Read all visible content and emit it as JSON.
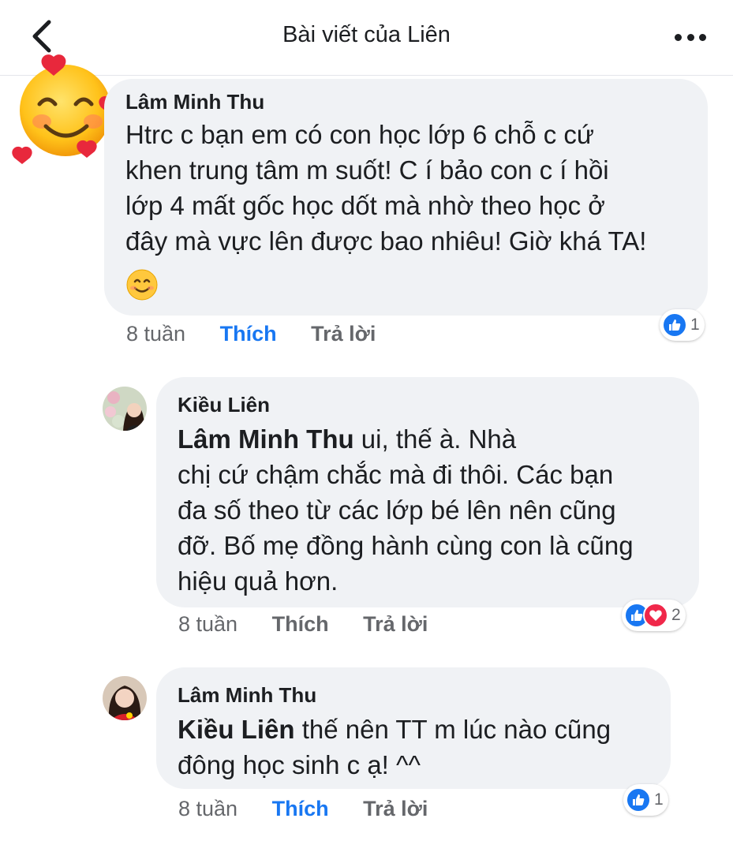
{
  "header": {
    "title": "Bài viết của Liên",
    "back_icon": "chevron-left-icon",
    "more_icon": "more-dots-icon"
  },
  "comments": [
    {
      "author": "Lâm Minh Thu",
      "text_lines": [
        "Htrc c bạn em có con học lớp 6 chỗ c cứ",
        "khen trung tâm m suốt! C í bảo con c í hồi",
        "lớp 4 mất gốc học dốt mà nhờ theo học ở",
        "đây mà vực lên được bao nhiêu! Giờ khá TA!"
      ],
      "emoji": "😊",
      "time": "8 tuần",
      "like": "Thích",
      "reply": "Trả lời",
      "like_active": true,
      "reaction_count": "1",
      "avatar_icon": "smiling-face-with-hearts-emoji"
    },
    {
      "author": "Kiều Liên",
      "mention": "Lâm Minh Thu",
      "first_line_rest": " ui, thế à. Nhà",
      "text_lines": [
        "chị cứ chậm chắc mà đi thôi. Các bạn",
        "đa số theo từ các lớp bé lên nên cũng",
        "đỡ. Bố mẹ đồng hành cùng con là cũng",
        "hiệu quả hơn."
      ],
      "time": "8 tuần",
      "like": "Thích",
      "reply": "Trả lời",
      "like_active": false,
      "reaction_count": "2"
    },
    {
      "author": "Lâm Minh Thu",
      "mention": "Kiều Liên",
      "first_line_rest": " thế nên TT m lúc nào cũng",
      "text_lines": [
        "đông học sinh c ạ! ^^"
      ],
      "time": "8 tuần",
      "like": "Thích",
      "reply": "Trả lời",
      "like_active": true,
      "reaction_count": "1"
    }
  ],
  "colors": {
    "accent": "#1877f2",
    "bubble": "#f0f2f5",
    "meta": "#65676b",
    "love": "#f0284a"
  }
}
